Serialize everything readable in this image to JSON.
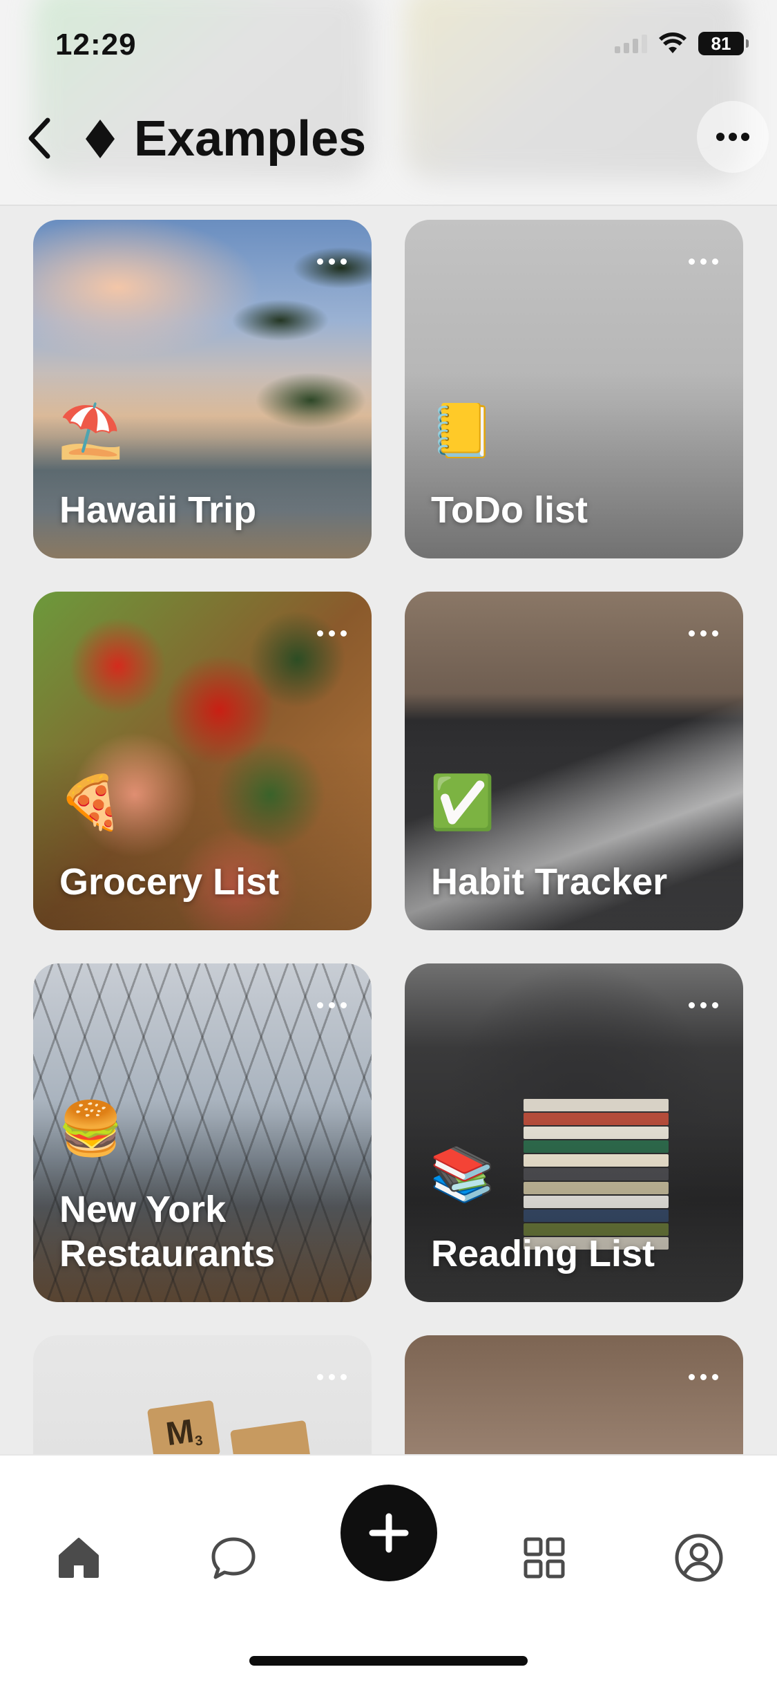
{
  "status_bar": {
    "time": "12:29",
    "battery": "81"
  },
  "header": {
    "title": "Examples",
    "back_icon": "chevron-left-icon",
    "title_icon": "diamond-icon",
    "more_icon": "ellipsis-icon"
  },
  "cards": [
    {
      "title": "Hawaii Trip",
      "emoji": "⛱️"
    },
    {
      "title": "ToDo list",
      "emoji": "📒"
    },
    {
      "title": "Grocery List",
      "emoji": "🍕"
    },
    {
      "title": "Habit Tracker",
      "emoji": "✅"
    },
    {
      "title": "New York Restaurants",
      "emoji": "🍔"
    },
    {
      "title": "Reading List",
      "emoji": "📚"
    },
    {
      "title": "",
      "emoji": ""
    },
    {
      "title": "",
      "emoji": ""
    }
  ],
  "scrabble_tile": {
    "letter": "M",
    "subscript": "3"
  },
  "tab_bar": {
    "items": [
      {
        "icon": "home-icon"
      },
      {
        "icon": "chat-bubble-icon"
      },
      {
        "icon": "plus-icon"
      },
      {
        "icon": "grid-icon"
      },
      {
        "icon": "profile-icon"
      }
    ]
  },
  "colors": {
    "accent": "#0f0f0f",
    "tab_inactive": "#4b4b4b",
    "background": "#ececec"
  }
}
